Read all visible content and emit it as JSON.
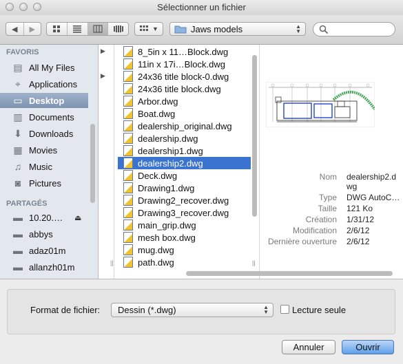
{
  "window": {
    "title": "Sélectionner un fichier"
  },
  "toolbar": {
    "back_icon": "back-arrow-icon",
    "forward_icon": "forward-arrow-icon",
    "view_modes": [
      "icon-view",
      "list-view",
      "column-view",
      "coverflow-view"
    ],
    "selected_view": "column-view",
    "arrange_icon": "arrange-grid-icon",
    "location": "Jaws models",
    "search_placeholder": ""
  },
  "sidebar": {
    "favorites_header": "FAVORIS",
    "favorites": [
      {
        "label": "All My Files",
        "icon": "all-files-icon"
      },
      {
        "label": "Applications",
        "icon": "applications-icon"
      },
      {
        "label": "Desktop",
        "icon": "desktop-icon",
        "selected": true
      },
      {
        "label": "Documents",
        "icon": "documents-icon"
      },
      {
        "label": "Downloads",
        "icon": "downloads-icon"
      },
      {
        "label": "Movies",
        "icon": "movies-icon"
      },
      {
        "label": "Music",
        "icon": "music-icon"
      },
      {
        "label": "Pictures",
        "icon": "pictures-icon"
      }
    ],
    "shared_header": "PARTAGÉS",
    "shared": [
      {
        "label": "10.20.…",
        "icon": "computer-icon",
        "eject": true
      },
      {
        "label": "abbys",
        "icon": "computer-icon"
      },
      {
        "label": "adaz01m",
        "icon": "computer-icon"
      },
      {
        "label": "allanzh01m",
        "icon": "computer-icon"
      }
    ]
  },
  "files": [
    "8_5in x 11…Block.dwg",
    "11in x 17i…Block.dwg",
    "24x36 title block-0.dwg",
    "24x36 title block.dwg",
    "Arbor.dwg",
    "Boat.dwg",
    "dealership_original.dwg",
    "dealership.dwg",
    "dealership1.dwg",
    "dealership2.dwg",
    "Deck.dwg",
    "Drawing1.dwg",
    "Drawing2_recover.dwg",
    "Drawing3_recover.dwg",
    "main_grip.dwg",
    "mesh box.dwg",
    "mug.dwg",
    "path.dwg"
  ],
  "selected_file_index": 9,
  "preview": {
    "meta": [
      {
        "key": "Nom",
        "value": "dealership2.d"
      },
      {
        "key": "",
        "value": "wg"
      },
      {
        "key": "Type",
        "value": "DWG AutoC…"
      },
      {
        "key": "Taille",
        "value": "121 Ko"
      },
      {
        "key": "Création",
        "value": "1/31/12"
      },
      {
        "key": "Modification",
        "value": "2/6/12"
      },
      {
        "key": "Dernière ouverture",
        "value": "2/6/12"
      }
    ]
  },
  "format": {
    "label": "Format de fichier:",
    "value": "Dessin (*.dwg)",
    "readonly_label": "Lecture seule"
  },
  "buttons": {
    "cancel": "Annuler",
    "open": "Ouvrir"
  },
  "colors": {
    "selection": "#3b73d1",
    "sidebar_selection": "#7d93b0",
    "sidebar_bg": "#e3e8ee"
  }
}
